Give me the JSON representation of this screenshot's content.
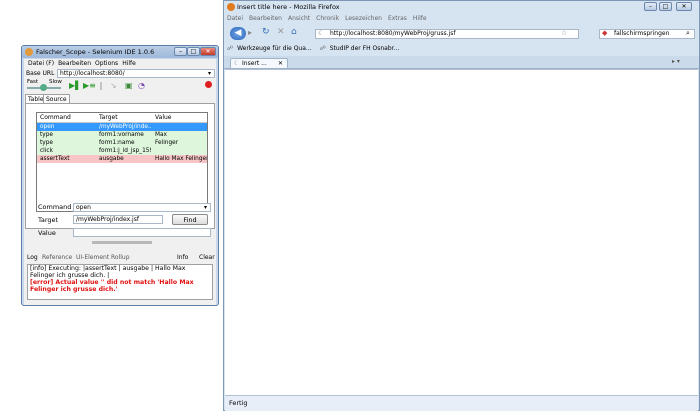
{
  "selenium": {
    "title": "Falscher_Scope - Selenium IDE 1.0.6",
    "menu": [
      "Datei (F)",
      "Bearbeiten",
      "Options",
      "Hilfe"
    ],
    "base_url_label": "Base URL",
    "base_url_value": "http://localhost:8080/",
    "speed_fast": "Fast",
    "speed_slow": "Slow",
    "tabs": [
      "Table",
      "Source"
    ],
    "table": {
      "headers": [
        "Command",
        "Target",
        "Value"
      ],
      "rows": [
        {
          "command": "open",
          "target": "/myWebProj/inde...",
          "value": ""
        },
        {
          "command": "type",
          "target": "form1:vorname",
          "value": "Max"
        },
        {
          "command": "type",
          "target": "form1:name",
          "value": "Felinger"
        },
        {
          "command": "click",
          "target": "form1:j_id_jsp_159...",
          "value": ""
        },
        {
          "command": "assertText",
          "target": "ausgabe",
          "value": "Hallo Max Felinger..."
        }
      ]
    },
    "command_label": "Command",
    "command_value": "open",
    "target_label": "Target",
    "target_value": "/myWebProj/index.jsf",
    "value_label": "Value",
    "value_value": "",
    "find_label": "Find",
    "log_tabs": [
      "Log",
      "Reference",
      "UI-Element",
      "Rollup"
    ],
    "info_label": "Info",
    "clear_label": "Clear",
    "log_lines": [
      "[info] Executing: |assertText | ausgabe | Hallo Max Felinger ich grusse dich. |"
    ],
    "log_error": "[error] Actual value '' did not match 'Hallo Max Felinger ich grusse dich.'",
    "colors": {
      "selected_row": "#3399ff",
      "passed_row": "#ddf6dc",
      "failed_row": "#f7c5c5",
      "error_text": "#e01010"
    }
  },
  "firefox": {
    "title": "Insert title here - Mozilla Firefox",
    "menu": [
      "Datei",
      "Bearbeiten",
      "Ansicht",
      "Chronik",
      "Lesezeichen",
      "Extras",
      "Hilfe"
    ],
    "url": "http://localhost:8080/myWebProj/gruss.jsf",
    "search_value": "fallschirmspringen",
    "bookmarks": [
      "Werkzeuge für die Qua...",
      "StudIP der FH Osnabr..."
    ],
    "tab_label": "Insert ...",
    "status": "Fertig"
  }
}
